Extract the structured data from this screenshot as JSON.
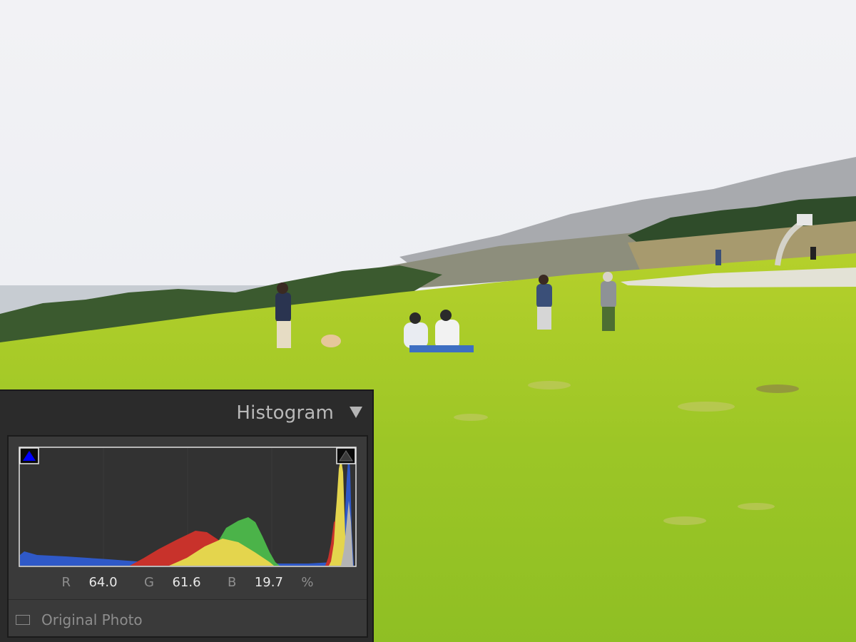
{
  "histogram": {
    "title": "Histogram",
    "collapse_icon": "triangle-down-icon",
    "shadow_clipping_icon": "triangle-up-icon",
    "highlight_clipping_icon": "triangle-up-icon",
    "shadow_clip_color": "#0000ff",
    "highlight_clip_color": "#333333",
    "readout": {
      "r_label": "R",
      "r_value": "64.0",
      "g_label": "G",
      "g_value": "61.6",
      "b_label": "B",
      "b_value": "19.7",
      "unit": "%"
    },
    "original_photo_label": "Original Photo",
    "original_photo_checked": false
  },
  "colors": {
    "panel_bg": "#2b2b2b",
    "histogram_bg": "#3a3a3a",
    "red_channel": "#c8322b",
    "green_channel": "#4bb349",
    "blue_channel": "#2f59c8",
    "yellow_overlap": "#e4d54d",
    "grass": "#9bc42a",
    "sky": "#f1f2f5"
  }
}
